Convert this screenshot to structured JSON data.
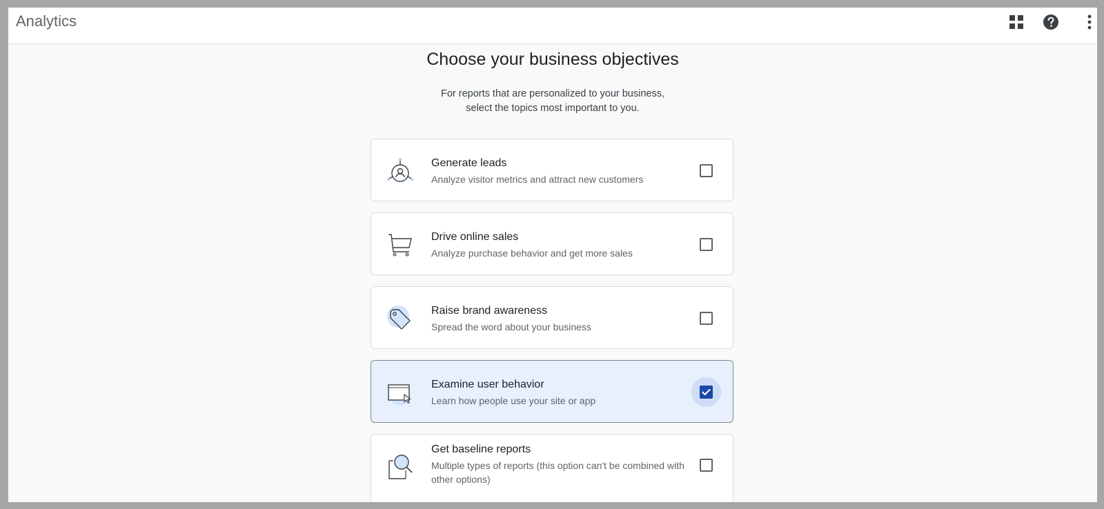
{
  "app": {
    "title": "Analytics",
    "icons": [
      "apps-grid-icon",
      "help-icon",
      "more-vert-icon"
    ]
  },
  "page": {
    "heading": "Choose your business objectives",
    "subtext_line1": "For reports that are personalized to your business,",
    "subtext_line2": "select the topics most important to you."
  },
  "objectives": [
    {
      "title": "Generate leads",
      "description": "Analyze visitor metrics and attract new customers",
      "icon": "leads-target-icon",
      "checked": false
    },
    {
      "title": "Drive online sales",
      "description": "Analyze purchase behavior and get more sales",
      "icon": "shopping-cart-icon",
      "checked": false
    },
    {
      "title": "Raise brand awareness",
      "description": "Spread the word about your business",
      "icon": "tag-icon",
      "checked": false
    },
    {
      "title": "Examine user behavior",
      "description": "Learn how people use your site or app",
      "icon": "browser-cursor-icon",
      "checked": true
    },
    {
      "title": "Get baseline reports",
      "description": "Multiple types of reports (this option can't be combined with other options)",
      "icon": "report-magnifier-icon",
      "checked": false
    }
  ],
  "colors": {
    "accent": "#1a47a8",
    "selected_background": "#e8f0fe",
    "page_background": "#f8f9fa"
  }
}
